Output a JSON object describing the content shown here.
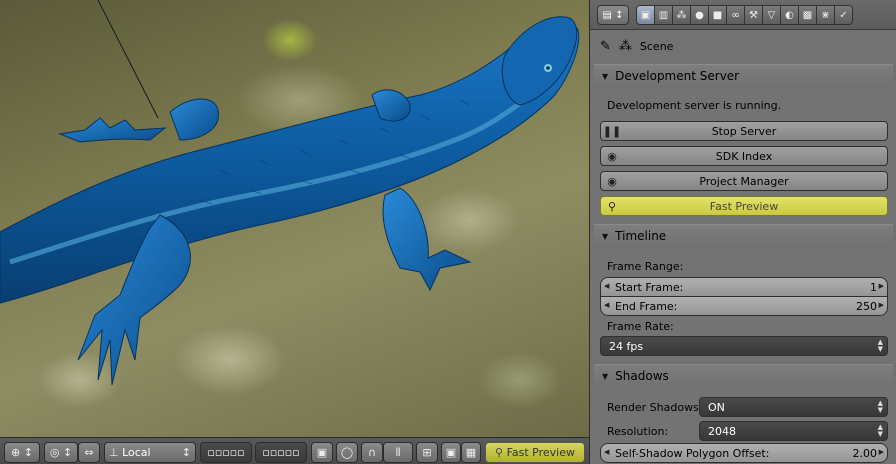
{
  "viewport_header": {
    "orientation_label": "Local",
    "fast_preview_label": "Fast Preview"
  },
  "properties": {
    "breadcrumb": "Scene",
    "dev_server": {
      "title": "Development Server",
      "status": "Development server is running.",
      "stop_label": "Stop Server",
      "sdk_label": "SDK Index",
      "project_label": "Project Manager",
      "fast_preview_label": "Fast Preview"
    },
    "timeline": {
      "title": "Timeline",
      "frame_range_label": "Frame Range:",
      "start_label": "Start Frame:",
      "start_value": "1",
      "end_label": "End Frame:",
      "end_value": "250",
      "frame_rate_label": "Frame Rate:",
      "frame_rate_value": "24 fps"
    },
    "shadows": {
      "title": "Shadows",
      "render_label": "Render Shadows:",
      "render_value": "ON",
      "resolution_label": "Resolution:",
      "resolution_value": "2048",
      "offset_label": "Self-Shadow Polygon Offset:",
      "offset_value": "2.00"
    }
  },
  "colors": {
    "highlight_yellow": "#d6d65a",
    "panel_bg": "#727272",
    "lizard_blue": "#0f5fa8"
  }
}
